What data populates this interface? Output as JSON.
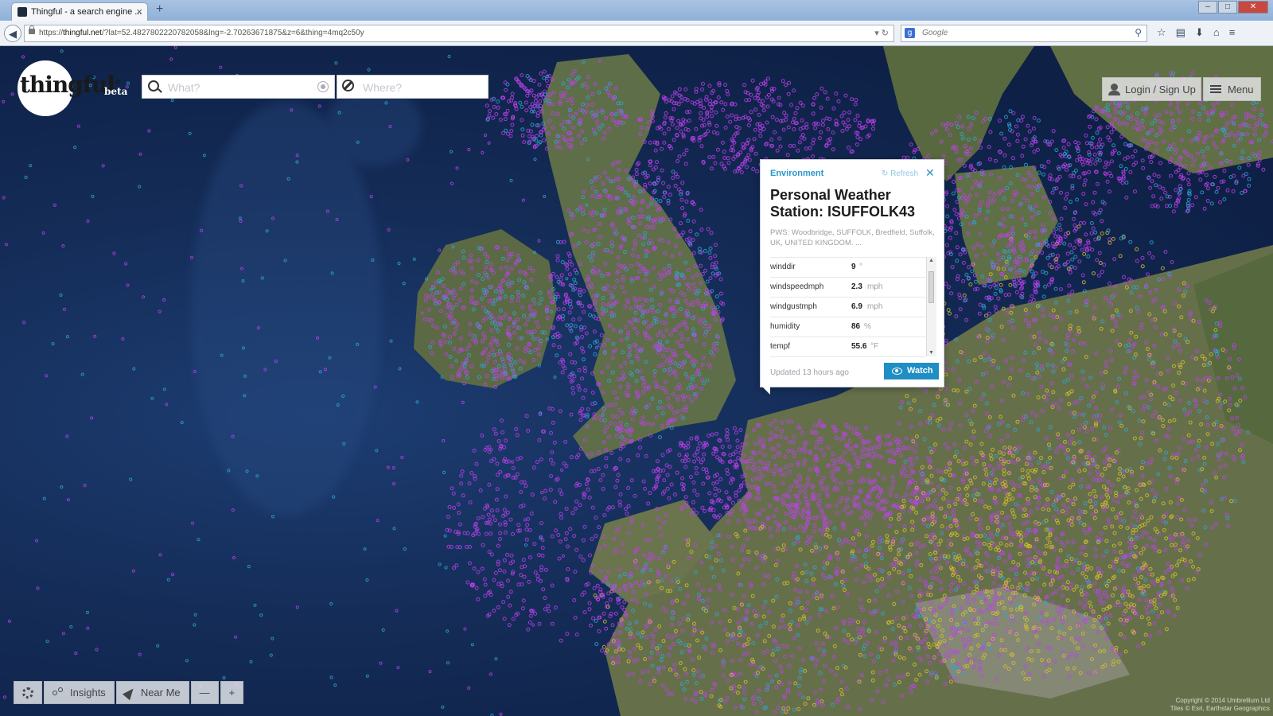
{
  "browser": {
    "tab_title": "Thingful - a search engine ...",
    "tab_close": "×",
    "new_tab": "+",
    "url_domain": "thingful.net",
    "url_prefix": "https://",
    "url_path": "/?lat=52.4827802220782058&lng=-2.70263671875&z=6&thing=4mq2c50y",
    "search_engine": "Google",
    "search_placeholder": "Google"
  },
  "app": {
    "logo_text": "thingful",
    "logo_mark": "®",
    "beta_label": "beta",
    "what_placeholder": "What?",
    "where_placeholder": "Where?",
    "login_label": "Login / Sign Up",
    "menu_label": "Menu"
  },
  "popup": {
    "category": "Environment",
    "refresh_label": "Refresh",
    "close_label": "✕",
    "title": "Personal Weather Station: ISUFFOLK43",
    "description": "PWS: Woodbridge, SUFFOLK, Bredfield, Suffolk, UK, UNITED KINGDOM. ...",
    "rows": [
      {
        "key": "winddir",
        "value": "9",
        "unit": "°"
      },
      {
        "key": "windspeedmph",
        "value": "2.3",
        "unit": "mph"
      },
      {
        "key": "windgustmph",
        "value": "6.9",
        "unit": "mph"
      },
      {
        "key": "humidity",
        "value": "86",
        "unit": "%"
      },
      {
        "key": "tempf",
        "value": "55.6",
        "unit": "°F"
      }
    ],
    "updated": "Updated 13 hours ago",
    "watch_label": "Watch"
  },
  "toolbar": {
    "insights_label": "Insights",
    "near_me_label": "Near Me",
    "zoom_out": "—",
    "zoom_in": "+"
  },
  "map": {
    "copyright_line1": "Copyright © 2014 Umbrellium Ltd",
    "copyright_line2": "Tiles © Esri, Earthstar Geographics",
    "colors": {
      "ocean": "#142c57",
      "land": "#5e6e48",
      "marker_magenta": "#c040f0",
      "marker_cyan": "#30a8d8",
      "marker_yellow": "#d8c030",
      "accent": "#1f8ec4"
    }
  }
}
